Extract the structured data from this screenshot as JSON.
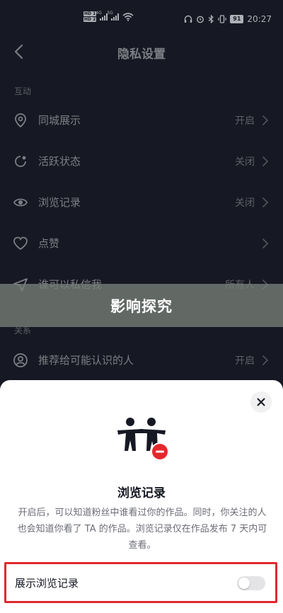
{
  "status_bar": {
    "hd1": "HD 1",
    "hd2": "HD 2",
    "sig1_label": "4G",
    "sig2_label": "5G",
    "battery": "91",
    "time": "20:27"
  },
  "header": {
    "title": "隐私设置",
    "back_icon": "chevron-left-icon"
  },
  "sections": {
    "interaction_label": "互动",
    "relations_label": "关系"
  },
  "settings": [
    {
      "label": "同城展示",
      "value": "开启",
      "icon": "location-pin-icon"
    },
    {
      "label": "活跃状态",
      "value": "关闭",
      "icon": "activity-status-icon"
    },
    {
      "label": "浏览记录",
      "value": "关闭",
      "icon": "eye-icon"
    },
    {
      "label": "点赞",
      "value": "",
      "icon": "heart-icon"
    },
    {
      "label": "谁可以私信我",
      "value": "所有人",
      "icon": "send-icon"
    },
    {
      "label": "推荐给可能认识的人",
      "value": "开启",
      "icon": "person-circle-icon"
    }
  ],
  "banner": {
    "text": "影响探究"
  },
  "sheet": {
    "title": "浏览记录",
    "description": "开启后，可以知道粉丝中谁看过你的作品。同时，你关注的人也会知道你看了 TA 的作品。浏览记录仅在作品发布 7 天内可查看。",
    "toggle_label": "展示浏览记录",
    "toggle_on": false
  },
  "colors": {
    "background": "#161823",
    "accent_red": "#e2282d",
    "sheet_bg": "#ffffff"
  }
}
